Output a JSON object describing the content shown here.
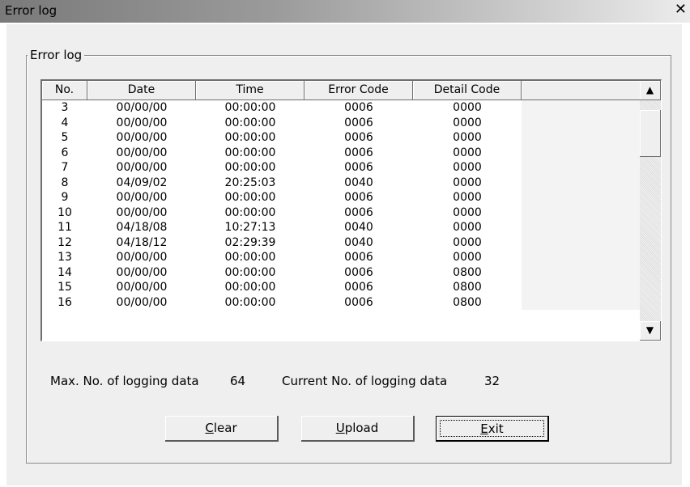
{
  "window": {
    "title": "Error log",
    "close_label": "✕"
  },
  "group": {
    "label": "Error log"
  },
  "table": {
    "columns": [
      "No.",
      "Date",
      "Time",
      "Error Code",
      "Detail Code"
    ],
    "rows": [
      [
        "3",
        "00/00/00",
        "00:00:00",
        "0006",
        "0000"
      ],
      [
        "4",
        "00/00/00",
        "00:00:00",
        "0006",
        "0000"
      ],
      [
        "5",
        "00/00/00",
        "00:00:00",
        "0006",
        "0000"
      ],
      [
        "6",
        "00/00/00",
        "00:00:00",
        "0006",
        "0000"
      ],
      [
        "7",
        "00/00/00",
        "00:00:00",
        "0006",
        "0000"
      ],
      [
        "8",
        "04/09/02",
        "20:25:03",
        "0040",
        "0000"
      ],
      [
        "9",
        "00/00/00",
        "00:00:00",
        "0006",
        "0000"
      ],
      [
        "10",
        "00/00/00",
        "00:00:00",
        "0006",
        "0000"
      ],
      [
        "11",
        "04/18/08",
        "10:27:13",
        "0040",
        "0000"
      ],
      [
        "12",
        "04/18/12",
        "02:29:39",
        "0040",
        "0000"
      ],
      [
        "13",
        "00/00/00",
        "00:00:00",
        "0006",
        "0000"
      ],
      [
        "14",
        "00/00/00",
        "00:00:00",
        "0006",
        "0800"
      ],
      [
        "15",
        "00/00/00",
        "00:00:00",
        "0006",
        "0800"
      ],
      [
        "16",
        "00/00/00",
        "00:00:00",
        "0006",
        "0800"
      ]
    ]
  },
  "scrollbar": {
    "up_icon": "▲",
    "down_icon": "▼"
  },
  "info": {
    "max_label": "Max. No. of logging data",
    "max_value": "64",
    "current_label": "Current No. of logging data",
    "current_value": "32"
  },
  "buttons": {
    "clear": {
      "mnemonic": "C",
      "rest": "lear"
    },
    "upload": {
      "mnemonic": "U",
      "rest": "pload"
    },
    "exit": {
      "mnemonic": "E",
      "rest": "xit"
    }
  }
}
